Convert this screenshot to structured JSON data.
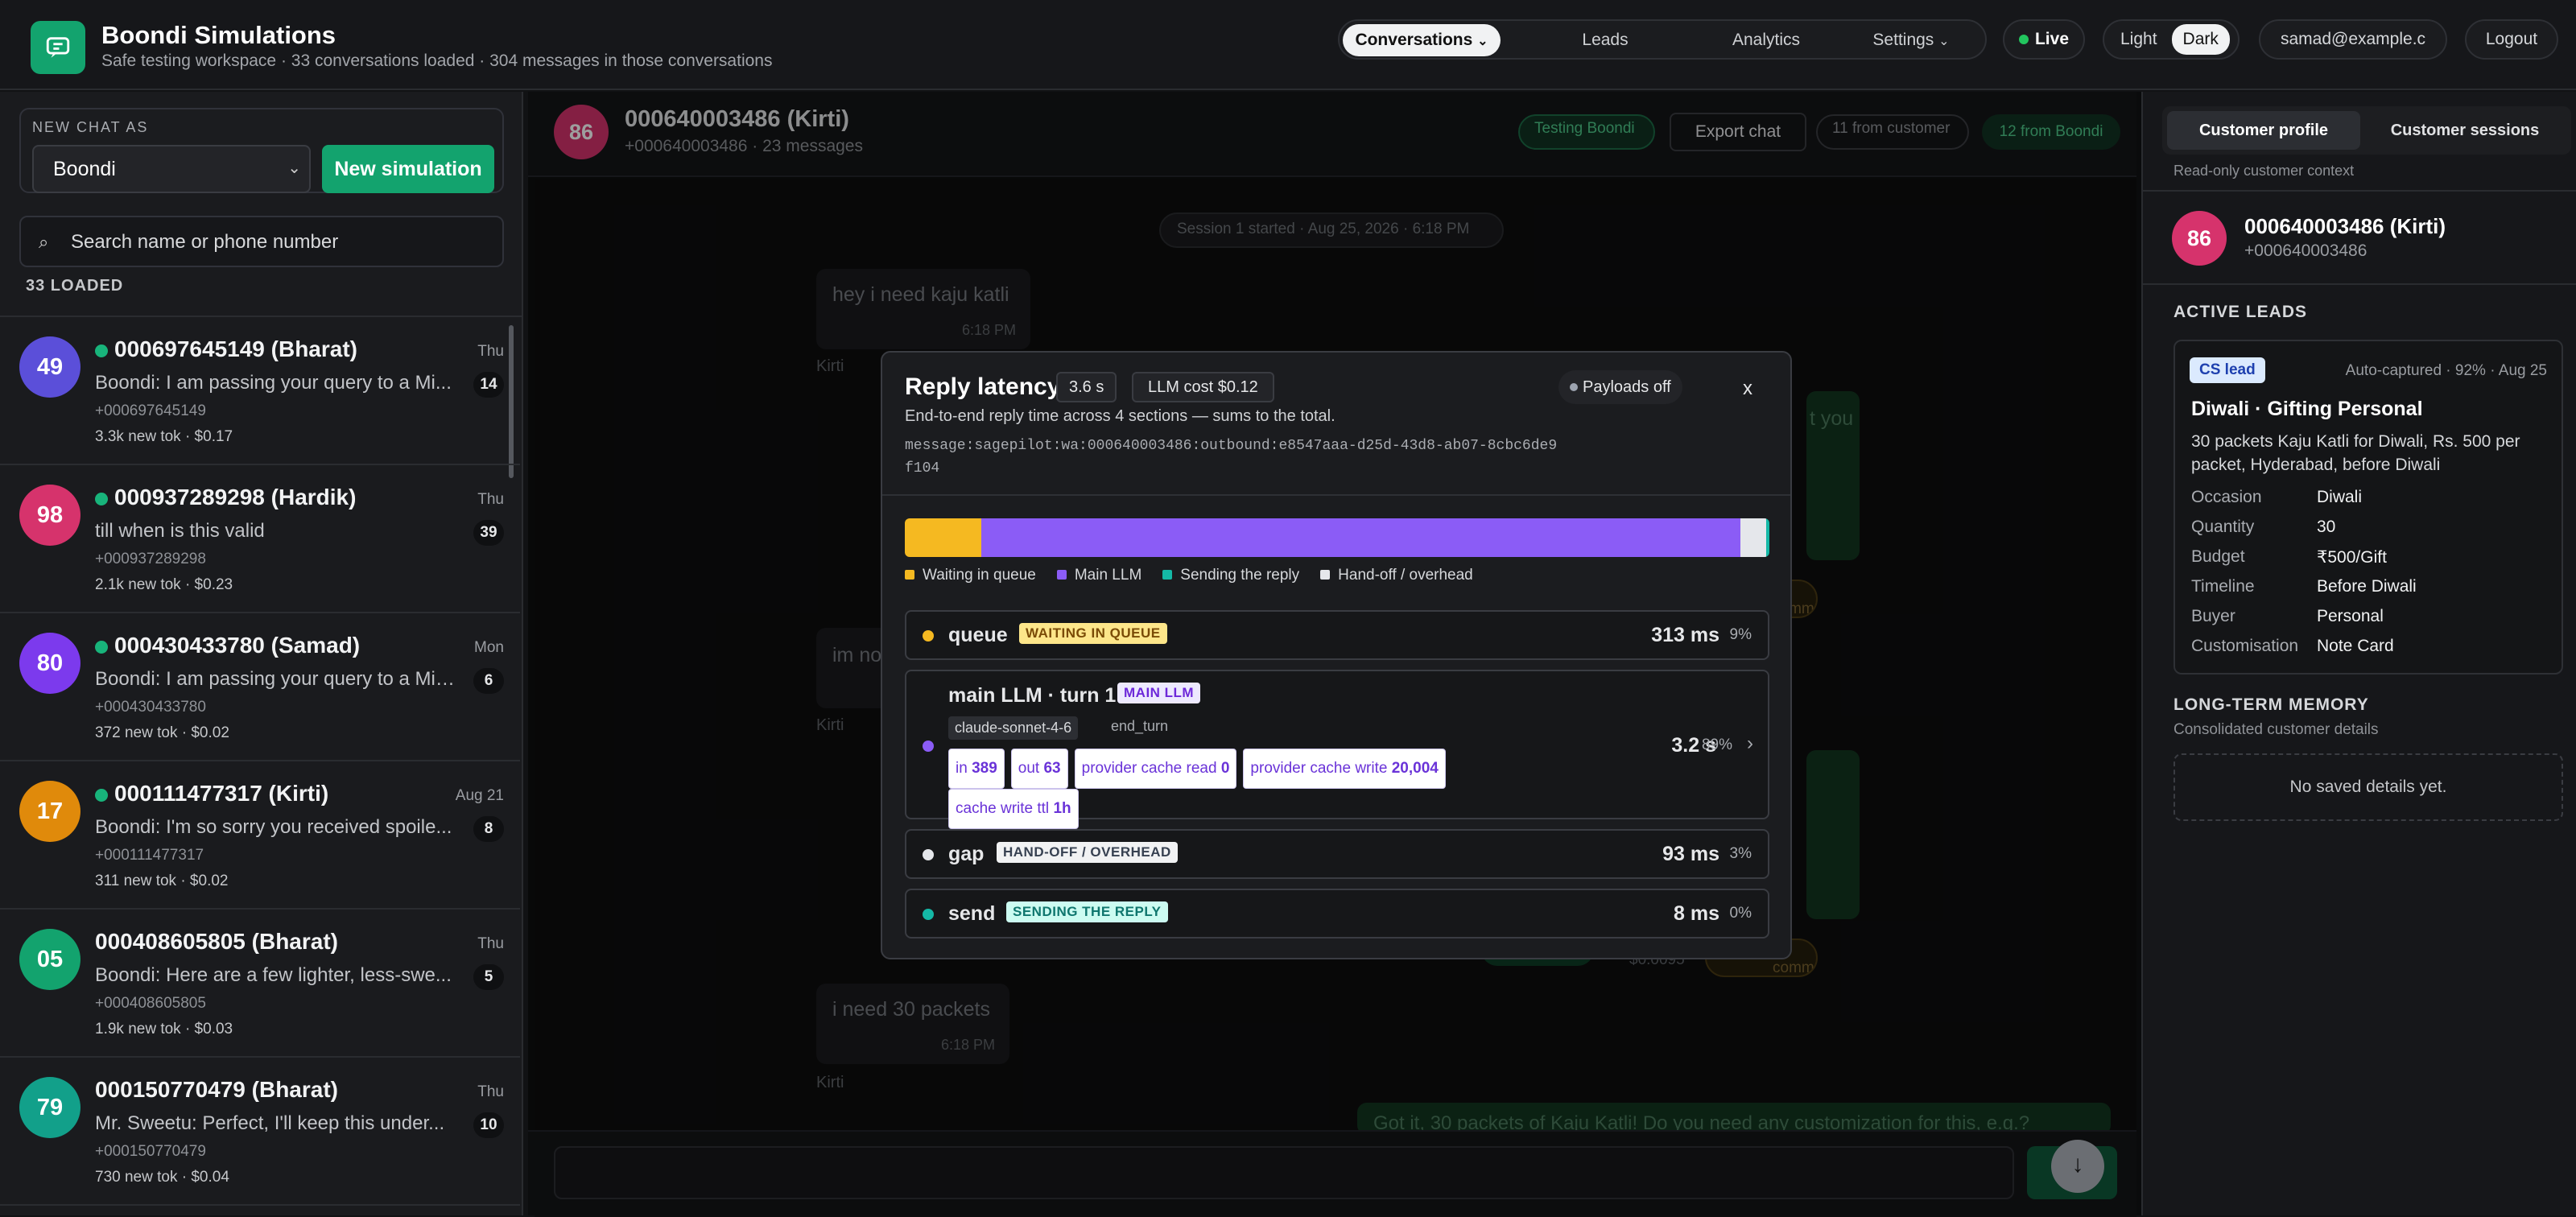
{
  "app": {
    "title": "Boondi Simulations",
    "subtitle": "Safe testing workspace · 33 conversations loaded · 304 messages in those conversations"
  },
  "nav": {
    "tabs": [
      "Conversations",
      "Leads",
      "Analytics",
      "Settings"
    ],
    "active": "Conversations",
    "live_label": "Live",
    "theme_light": "Light",
    "theme_dark": "Dark",
    "user_email": "samad@example.c",
    "logout_label": "Logout"
  },
  "sidebar": {
    "new_chat_label": "NEW CHAT AS",
    "persona_value": "Boondi",
    "new_sim_button": "New simulation",
    "search_placeholder": "Search name or phone number",
    "loaded_label": "33 LOADED",
    "conversations": [
      {
        "initials": "49",
        "name": "000697645149 (Bharat)",
        "day": "Thu",
        "preview": "Boondi: I am passing your query to a Mi...",
        "count": "14",
        "phone": "+000697645149",
        "tokens": "3.3k new tok · $0.17",
        "online": true,
        "color": "#5b4fd9"
      },
      {
        "initials": "98",
        "name": "000937289298 (Hardik)",
        "day": "Thu",
        "preview": "till when is this valid",
        "count": "39",
        "phone": "+000937289298",
        "tokens": "2.1k new tok · $0.23",
        "online": true,
        "color": "#d6336c"
      },
      {
        "initials": "80",
        "name": "000430433780 (Samad)",
        "day": "Mon",
        "preview": "Boondi: I am passing your query to a Mit...",
        "count": "6",
        "phone": "+000430433780",
        "tokens": "372 new tok · $0.02",
        "online": true,
        "color": "#7c3aed"
      },
      {
        "initials": "17",
        "name": "000111477317 (Kirti)",
        "day": "Aug 21",
        "preview": "Boondi: I'm so sorry you received spoile...",
        "count": "8",
        "phone": "+000111477317",
        "tokens": "311 new tok · $0.02",
        "online": true,
        "color": "#e08a0b"
      },
      {
        "initials": "05",
        "name": "000408605805 (Bharat)",
        "day": "Thu",
        "preview": "Boondi: Here are a few lighter, less-swe...",
        "count": "5",
        "phone": "+000408605805",
        "tokens": "1.9k new tok · $0.03",
        "online": false,
        "color": "#13a36e"
      },
      {
        "initials": "79",
        "name": "000150770479 (Bharat)",
        "day": "Thu",
        "preview": "Mr. Sweetu: Perfect, I'll keep this under...",
        "count": "10",
        "phone": "+000150770479",
        "tokens": "730 new tok · $0.04",
        "online": false,
        "color": "#12a08a"
      }
    ]
  },
  "chat": {
    "avatar": "86",
    "title": "000640003486 (Kirti)",
    "subtitle": "+000640003486 · 23 messages",
    "testing_label": "Testing Boondi",
    "export_label": "Export chat",
    "from_customer": "11 from customer",
    "from_boondi": "12 from Boondi",
    "session_label": "Session 1 started · Aug 25, 2026 · 6:18 PM",
    "messages": [
      {
        "text": "hey i need kaju katli",
        "time": "6:18 PM",
        "sender": "Kirti"
      },
      {
        "text": "im no",
        "time": "",
        "sender": "Kirti"
      },
      {
        "text": "i need 30 packets",
        "time": "6:18 PM",
        "sender": "Kirti"
      }
    ],
    "partial_you": "t you",
    "partial_comment": "d comment",
    "partial_cost": "$0.0095",
    "outgoing_partial": "Got it, 30 packets of Kaju Katli! Do you need any customization for this, e.g.?"
  },
  "modal": {
    "title": "Reply latency",
    "total": "3.6 s",
    "llm_cost": "LLM cost $0.12",
    "payloads": "Payloads off",
    "close": "x",
    "description": "End-to-end reply time across 4 sections — sums to the total.",
    "message_id": "message:sagepilot:wa:000640003486:outbound:e8547aaa-d25d-43d8-ab07-8cbc6de9f104",
    "legend": [
      {
        "label": "Waiting in queue",
        "color": "#f5b921"
      },
      {
        "label": "Main LLM",
        "color": "#8b5cf6"
      },
      {
        "label": "Sending the reply",
        "color": "#14b8a6"
      },
      {
        "label": "Hand-off / overhead",
        "color": "#e5e7eb"
      }
    ],
    "segments": [
      {
        "name": "queue",
        "fraction": 0.09,
        "color": "#f5b921"
      },
      {
        "name": "main LLM",
        "fraction": 0.89,
        "color": "#8b5cf6"
      },
      {
        "name": "gap",
        "fraction": 0.03,
        "color": "#e5e7eb"
      },
      {
        "name": "send",
        "fraction": 0.002,
        "color": "#14b8a6"
      }
    ],
    "rows": [
      {
        "name": "queue",
        "tag": "WAITING IN QUEUE",
        "value": "313 ms",
        "pct": "9%"
      },
      {
        "name": "main LLM · turn 1",
        "tag": "MAIN LLM",
        "model": "claude-sonnet-4-6",
        "stop": "end_turn",
        "value": "3.2 s",
        "pct": "89%"
      },
      {
        "name": "gap",
        "tag": "HAND-OFF / OVERHEAD",
        "value": "93 ms",
        "pct": "3%"
      },
      {
        "name": "send",
        "tag": "SENDING THE REPLY",
        "value": "8 ms",
        "pct": "0%"
      }
    ],
    "chips": [
      {
        "label": "in",
        "value": "389"
      },
      {
        "label": "out",
        "value": "63"
      },
      {
        "label": "provider cache read",
        "value": "0"
      },
      {
        "label": "provider cache write",
        "value": "20,004"
      },
      {
        "label": "cache write ttl",
        "value": "1h"
      }
    ]
  },
  "profile": {
    "tab_profile": "Customer profile",
    "tab_sessions": "Customer sessions",
    "readonly": "Read-only customer context",
    "avatar": "86",
    "name": "000640003486 (Kirti)",
    "phone": "+000640003486",
    "active_leads": "ACTIVE LEADS",
    "lead": {
      "badge": "CS lead",
      "meta": "Auto-captured · 92% · Aug 25",
      "title": "Diwali · Gifting Personal",
      "desc": "30 packets Kaju Katli for Diwali, Rs. 500 per packet, Hyderabad, before Diwali",
      "fields": [
        {
          "k": "Occasion",
          "v": "Diwali"
        },
        {
          "k": "Quantity",
          "v": "30"
        },
        {
          "k": "Budget",
          "v": "₹500/Gift"
        },
        {
          "k": "Timeline",
          "v": "Before Diwali"
        },
        {
          "k": "Buyer",
          "v": "Personal"
        },
        {
          "k": "Customisation",
          "v": "Note Card"
        }
      ]
    },
    "memory_title": "LONG-TERM MEMORY",
    "memory_sub": "Consolidated customer details",
    "memory_empty": "No saved details yet."
  }
}
